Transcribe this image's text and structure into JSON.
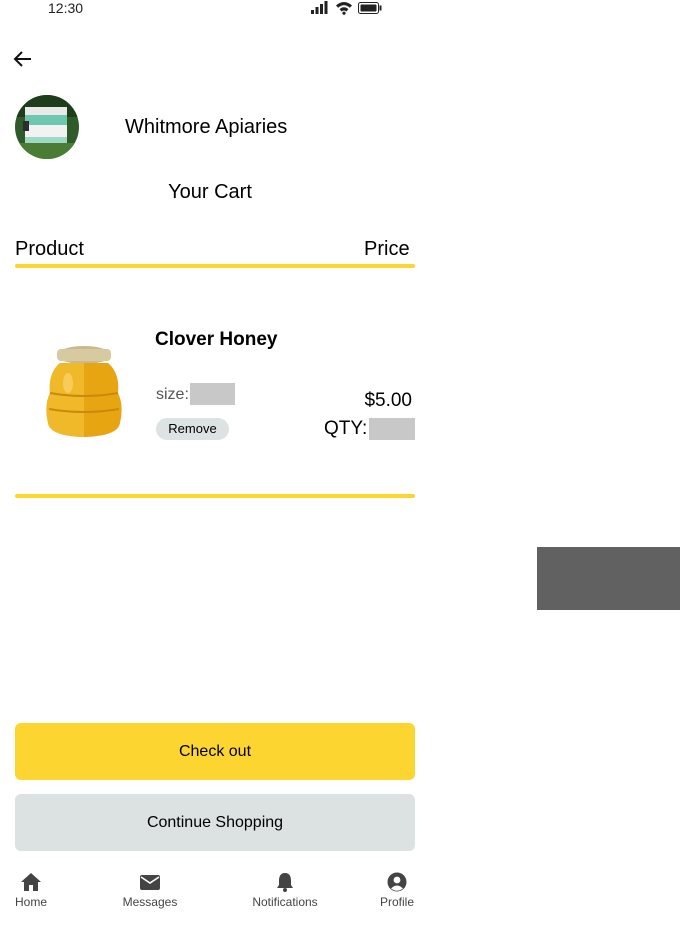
{
  "status_bar": {
    "time": "12:30"
  },
  "header": {
    "store_name": "Whitmore Apiaries"
  },
  "cart": {
    "title": "Your Cart",
    "columns": {
      "product": "Product",
      "price": "Price"
    },
    "items": [
      {
        "name": "Clover Honey",
        "size_label": "size:",
        "price": "$5.00",
        "qty_label": "QTY:",
        "remove_label": "Remove"
      }
    ]
  },
  "actions": {
    "checkout": "Check out",
    "continue": "Continue Shopping"
  },
  "bottom_nav": {
    "items": [
      {
        "label": "Home",
        "icon": "home-icon"
      },
      {
        "label": "Messages",
        "icon": "envelope-icon"
      },
      {
        "label": "Notifications",
        "icon": "bell-icon"
      },
      {
        "label": "Profile",
        "icon": "user-circle-icon"
      }
    ]
  },
  "colors": {
    "accent": "#fdd530",
    "secondary_button": "#dce1e1",
    "placeholder": "#c8c8c8"
  }
}
